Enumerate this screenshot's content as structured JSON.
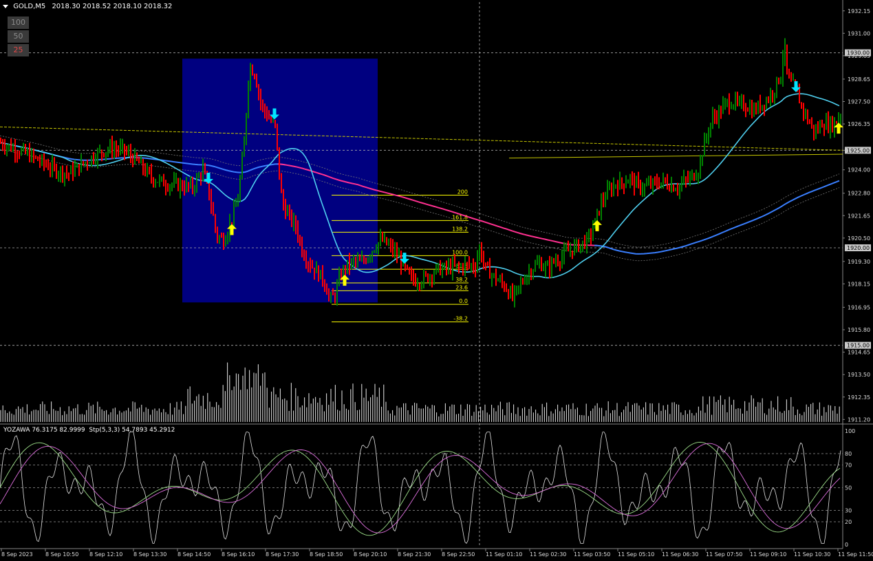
{
  "header": {
    "symbol": "GOLD,M5",
    "quote": "2018.30 2018.52 2018.10 2018.32",
    "menu_icon": "triangle-down-icon"
  },
  "scale_buttons": [
    {
      "label": "100",
      "color": "#8c8c8c",
      "bg": "#3a3a3a"
    },
    {
      "label": "50",
      "color": "#8c8c8c",
      "bg": "#3a3a3a"
    },
    {
      "label": "25",
      "color": "#e04848",
      "bg": "#3a3a3a"
    }
  ],
  "price_axis": {
    "labels": [
      "1932.15",
      "1931.00",
      "1929.85",
      "1928.65",
      "1927.50",
      "1926.35",
      "1925.00",
      "1924.00",
      "1922.80",
      "1921.65",
      "1920.50",
      "1919.30",
      "1918.15",
      "1916.95",
      "1915.80",
      "1914.65",
      "1913.50",
      "1912.35",
      "1911.20"
    ],
    "highlighted": [
      {
        "label": "1930.00",
        "price": 1930.0
      },
      {
        "label": "1925.00",
        "price": 1925.0
      },
      {
        "label": "1920.00",
        "price": 1920.0
      },
      {
        "label": "1915.00",
        "price": 1915.0
      }
    ]
  },
  "oscillator": {
    "header": "YOZAWA 76.3175 82.9999  Stp(5,3,3) 54.7893 45.2912",
    "levels": [
      "100",
      "80",
      "70",
      "50",
      "30",
      "20",
      "0"
    ]
  },
  "time_axis": [
    "8 Sep 2023",
    "8 Sep 10:50",
    "8 Sep 12:10",
    "8 Sep 13:30",
    "8 Sep 14:50",
    "8 Sep 16:10",
    "8 Sep 17:30",
    "8 Sep 18:50",
    "8 Sep 20:10",
    "8 Sep 21:30",
    "8 Sep 22:50",
    "11 Sep 01:10",
    "11 Sep 02:30",
    "11 Sep 03:50",
    "11 Sep 05:10",
    "11 Sep 06:30",
    "11 Sep 07:50",
    "11 Sep 09:10",
    "11 Sep 10:30",
    "11 Sep 11:50"
  ],
  "fibonacci": {
    "levels": [
      "200",
      "161.8",
      "138.2",
      "100.0",
      "61.8",
      "38.2",
      "23.6",
      "0.0",
      "-38.2"
    ],
    "color": "#ffff00"
  },
  "colors": {
    "background": "#000000",
    "bull_bar": "#008000",
    "bear_bar": "#ff0000",
    "fast_ma": "#4fd0f0",
    "slow_ma": "#3a7fff",
    "magenta_ma": "#ff3090",
    "rectangle": "#000080",
    "signal_up": "#ffff00",
    "signal_down": "#00e5ff"
  },
  "chart_data": {
    "type": "bar",
    "title": "GOLD,M5",
    "x_start": "8 Sep 2023",
    "x_end": "11 Sep 11:50",
    "ylim": [
      1911.0,
      1932.6
    ],
    "horizontal_lines": [
      1930.0,
      1925.0,
      1920.0,
      1915.0
    ],
    "price_path": [
      [
        0,
        1925.4
      ],
      [
        20,
        1925.1
      ],
      [
        40,
        1924.8
      ],
      [
        60,
        1924.4
      ],
      [
        80,
        1924.0
      ],
      [
        100,
        1923.8
      ],
      [
        120,
        1924.3
      ],
      [
        140,
        1924.8
      ],
      [
        160,
        1925.1
      ],
      [
        180,
        1925.0
      ],
      [
        200,
        1924.4
      ],
      [
        220,
        1923.6
      ],
      [
        240,
        1923.3
      ],
      [
        260,
        1923.2
      ],
      [
        280,
        1923.1
      ],
      [
        295,
        1924.0
      ],
      [
        305,
        1922.6
      ],
      [
        315,
        1920.6
      ],
      [
        325,
        1920.4
      ],
      [
        335,
        1921.3
      ],
      [
        345,
        1922.3
      ],
      [
        355,
        1925.3
      ],
      [
        362,
        1929.3
      ],
      [
        370,
        1929.0
      ],
      [
        380,
        1927.3
      ],
      [
        390,
        1926.7
      ],
      [
        400,
        1926.2
      ],
      [
        405,
        1924.2
      ],
      [
        410,
        1922.3
      ],
      [
        420,
        1921.6
      ],
      [
        430,
        1921.1
      ],
      [
        440,
        1919.8
      ],
      [
        450,
        1919.2
      ],
      [
        460,
        1918.8
      ],
      [
        470,
        1918.4
      ],
      [
        480,
        1917.3
      ],
      [
        487,
        1917.6
      ],
      [
        495,
        1918.6
      ],
      [
        505,
        1919.1
      ],
      [
        515,
        1919.3
      ],
      [
        525,
        1919.2
      ],
      [
        535,
        1919.6
      ],
      [
        545,
        1920.1
      ],
      [
        555,
        1920.4
      ],
      [
        565,
        1920.1
      ],
      [
        575,
        1919.7
      ],
      [
        585,
        1919.2
      ],
      [
        595,
        1918.5
      ],
      [
        605,
        1918.3
      ],
      [
        615,
        1918.4
      ],
      [
        625,
        1918.6
      ],
      [
        635,
        1918.9
      ],
      [
        645,
        1918.9
      ],
      [
        655,
        1919.0
      ],
      [
        665,
        1919.0
      ],
      [
        675,
        1919.1
      ],
      [
        685,
        1919.1
      ],
      [
        690,
        1919.0
      ],
      [
        697,
        1920.0
      ],
      [
        705,
        1919.0
      ],
      [
        715,
        1918.6
      ],
      [
        725,
        1918.3
      ],
      [
        735,
        1918.0
      ],
      [
        745,
        1917.4
      ],
      [
        755,
        1918.0
      ],
      [
        765,
        1918.6
      ],
      [
        775,
        1919.0
      ],
      [
        785,
        1919.2
      ],
      [
        795,
        1918.9
      ],
      [
        805,
        1919.3
      ],
      [
        815,
        1919.5
      ],
      [
        825,
        1919.8
      ],
      [
        835,
        1920.0
      ],
      [
        845,
        1920.2
      ],
      [
        855,
        1920.4
      ],
      [
        865,
        1921.3
      ],
      [
        875,
        1922.4
      ],
      [
        885,
        1922.9
      ],
      [
        895,
        1923.3
      ],
      [
        905,
        1923.3
      ],
      [
        915,
        1923.6
      ],
      [
        925,
        1923.2
      ],
      [
        935,
        1923.1
      ],
      [
        945,
        1923.2
      ],
      [
        955,
        1923.3
      ],
      [
        965,
        1923.4
      ],
      [
        975,
        1923.2
      ],
      [
        985,
        1923.1
      ],
      [
        995,
        1923.4
      ],
      [
        1005,
        1923.6
      ],
      [
        1015,
        1924.0
      ],
      [
        1025,
        1925.5
      ],
      [
        1035,
        1926.6
      ],
      [
        1045,
        1926.9
      ],
      [
        1055,
        1927.4
      ],
      [
        1065,
        1927.5
      ],
      [
        1075,
        1927.3
      ],
      [
        1085,
        1927.3
      ],
      [
        1095,
        1927.0
      ],
      [
        1105,
        1927.3
      ],
      [
        1115,
        1927.6
      ],
      [
        1125,
        1928.1
      ],
      [
        1135,
        1928.9
      ],
      [
        1140,
        1930.5
      ],
      [
        1145,
        1928.6
      ],
      [
        1155,
        1928.2
      ],
      [
        1165,
        1927.3
      ],
      [
        1175,
        1926.5
      ],
      [
        1185,
        1925.9
      ],
      [
        1195,
        1926.4
      ],
      [
        1205,
        1926.3
      ],
      [
        1215,
        1926.4
      ],
      [
        1220,
        1926.9
      ]
    ],
    "rectangle_price_range": [
      1917.2,
      1929.7
    ],
    "signals_up": [
      [
        337,
        1920.9
      ],
      [
        501,
        1918.3
      ],
      [
        868,
        1921.1
      ],
      [
        1219,
        1926.1
      ]
    ],
    "signals_down": [
      [
        303,
        1923.6
      ],
      [
        399,
        1926.9
      ],
      [
        588,
        1919.5
      ],
      [
        1157,
        1928.3
      ]
    ],
    "oscillator_ylim": [
      0,
      100
    ]
  }
}
